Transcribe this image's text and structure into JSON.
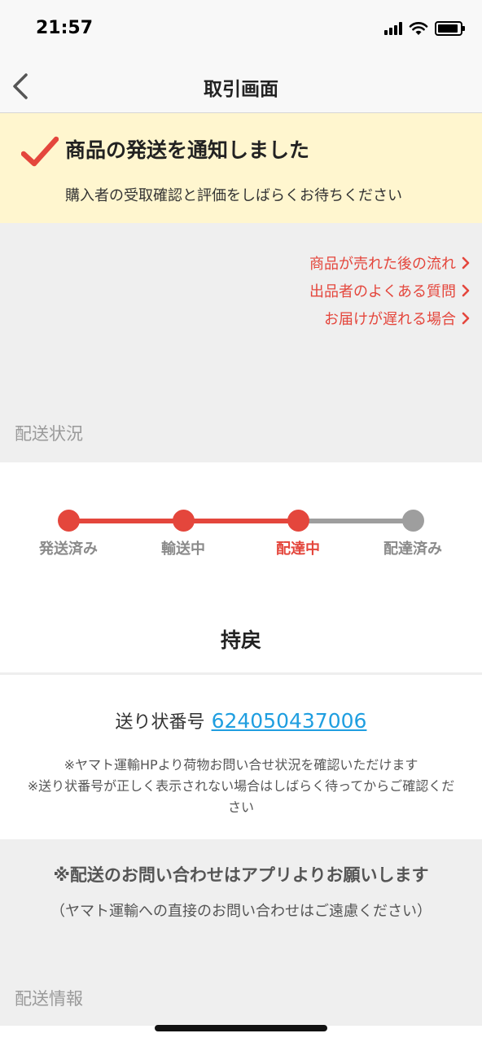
{
  "status_bar": {
    "time": "21:57"
  },
  "nav": {
    "title": "取引画面"
  },
  "notice": {
    "title": "商品の発送を通知しました",
    "message": "購入者の受取確認と評価をしばらくお待ちください"
  },
  "links": [
    {
      "label": "商品が売れた後の流れ"
    },
    {
      "label": "出品者のよくある質問"
    },
    {
      "label": "お届けが遅れる場合"
    }
  ],
  "sections": {
    "delivery_status": "配送状況",
    "delivery_info": "配送情報"
  },
  "progress": {
    "steps": [
      {
        "label": "発送済み",
        "state": "done"
      },
      {
        "label": "輸送中",
        "state": "done"
      },
      {
        "label": "配達中",
        "state": "current"
      },
      {
        "label": "配達済み",
        "state": "pending"
      }
    ],
    "status_text": "持戻"
  },
  "tracking": {
    "label": "送り状番号",
    "number": "624050437006",
    "note1": "※ヤマト運輸HPより荷物お問い合せ状況を確認いただけます",
    "note2": "※送り状番号が正しく表示されない場合はしばらく待ってからご確認ください"
  },
  "contact": {
    "title": "※配送のお問い合わせはアプリよりお願いします",
    "subtitle": "（ヤマト運輸への直接のお問い合わせはご遠慮ください）"
  },
  "colors": {
    "accent": "#e4463c",
    "link": "#1f9ee0",
    "notice_bg": "#fff6cf",
    "section_bg": "#efefef",
    "pending": "#9e9e9e"
  },
  "icons": {
    "back": "chevron-left-icon",
    "check": "check-icon",
    "link_arrow": "chevron-right-icon",
    "signal": "signal-icon",
    "wifi": "wifi-icon",
    "battery": "battery-icon"
  }
}
